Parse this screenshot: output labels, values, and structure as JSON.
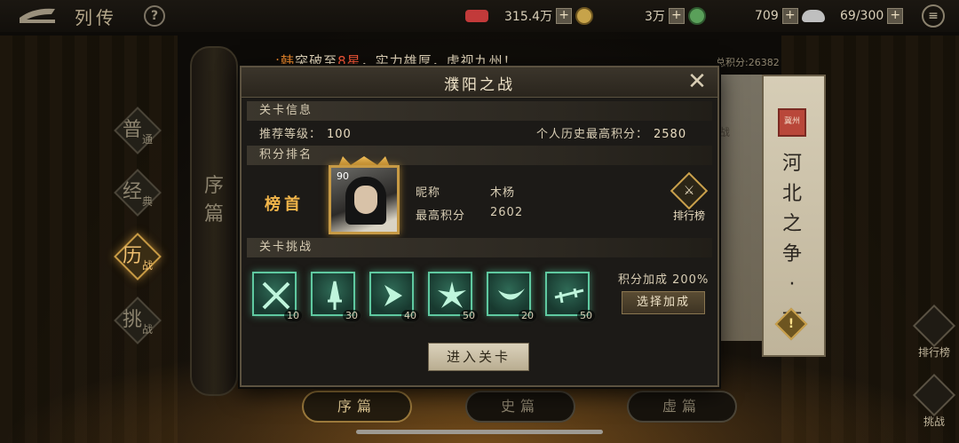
{
  "topbar": {
    "title": "列传",
    "help": "?",
    "resources": [
      {
        "value": "315.4万",
        "color": "#c23a3a"
      },
      {
        "value": "3万",
        "color": "#5aa05a"
      },
      {
        "value": "709",
        "color": "#bfbfbf"
      },
      {
        "value": "69/300",
        "color": ""
      }
    ],
    "plus": "+",
    "menu": "≡"
  },
  "side_tabs": [
    {
      "big": "普",
      "small": "通",
      "active": false
    },
    {
      "big": "经",
      "small": "典",
      "active": false
    },
    {
      "big": "历",
      "small": "战",
      "active": true
    },
    {
      "big": "挑",
      "small": "战",
      "active": false
    }
  ],
  "pillar_text": "序篇",
  "ticker": {
    "prefix": ":韩",
    "text1": "突破至",
    "stars": "8星",
    "text2": "，实力雄厚，虎视九州！"
  },
  "total_score": "总积分:26382",
  "right_scroll": {
    "seal": "冀州",
    "title": "河北之争·一",
    "warn": "!",
    "peek": "战"
  },
  "right_buttons": {
    "leaderboard": "排行榜",
    "challenge": "挑战"
  },
  "bottom_tabs": [
    {
      "label": "序篇",
      "active": true
    },
    {
      "label": "史篇",
      "active": false
    },
    {
      "label": "虚篇",
      "active": false
    }
  ],
  "modal": {
    "title": "濮阳之战",
    "close": "✕",
    "stage_info": {
      "header": "关卡信息",
      "recommended_label": "推荐等级：",
      "recommended_value": "100",
      "best_label": "个人历史最高积分：",
      "best_value": "2580"
    },
    "ranking": {
      "header": "积分排名",
      "rank_label": "榜首",
      "level": "90",
      "nickname_label": "昵称",
      "nickname_value": "木杨",
      "score_label": "最高积分",
      "score_value": "2602",
      "leaderboard_button": "排行榜",
      "leaderboard_icon": "⚔"
    },
    "challenge": {
      "header": "关卡挑战",
      "skills": [
        {
          "icon": "crossed-swords-icon",
          "level": "10"
        },
        {
          "icon": "sword-icon",
          "level": "30"
        },
        {
          "icon": "chevron-icon",
          "level": "40"
        },
        {
          "icon": "burst-icon",
          "level": "50"
        },
        {
          "icon": "crescent-icon",
          "level": "20"
        },
        {
          "icon": "rapier-icon",
          "level": "50"
        }
      ],
      "bonus_text": "积分加成 200%",
      "select_bonus": "选择加成"
    },
    "enter_button": "进入关卡"
  }
}
